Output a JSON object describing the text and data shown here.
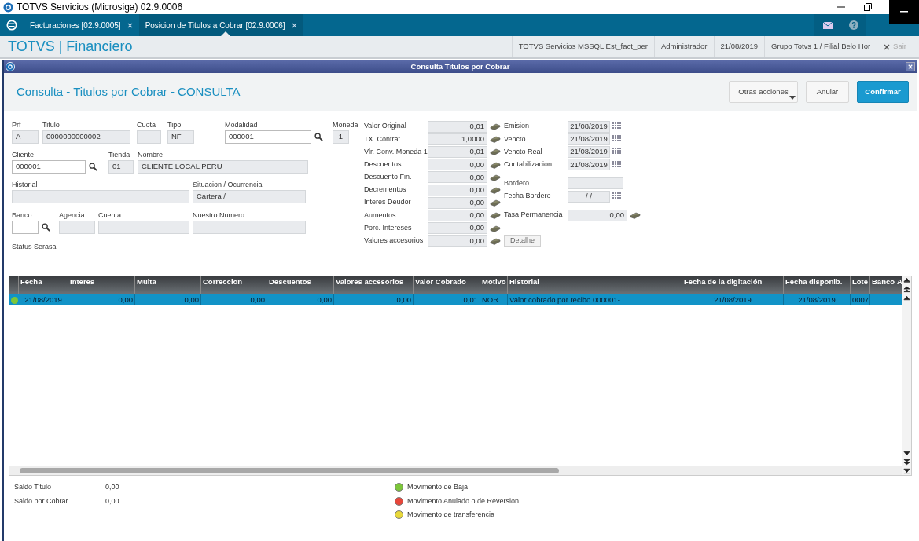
{
  "window": {
    "title": "TOTVS Servicios (Microsiga) 02.9.0006"
  },
  "tabs": [
    {
      "label": "Facturaciones [02.9.0005]",
      "selected": false
    },
    {
      "label": "Posicion de Titulos a Cobrar [02.9.0006]",
      "selected": true
    }
  ],
  "header": {
    "app_title": "TOTVS | Financiero",
    "info": [
      "TOTVS Servicios MSSQL Est_fact_per",
      "Administrador",
      "21/08/2019",
      "Grupo Totvs 1 / Filial Belo Hor"
    ],
    "exit": "Sair"
  },
  "dialog": {
    "title": "Consulta Titulos por Cobrar",
    "form_title": "Consulta - Titulos por Cobrar - CONSULTA",
    "buttons": [
      {
        "label": "Otras acciones",
        "kind": "menu"
      },
      {
        "label": "Anular",
        "kind": "plain"
      },
      {
        "label": "Confirmar",
        "kind": "primary"
      }
    ]
  },
  "fields": [
    [
      {
        "label": "Prf",
        "value": "A",
        "editable": false,
        "lookup": false
      },
      {
        "label": "Titulo",
        "value": "0000000000002",
        "editable": false,
        "lookup": false
      },
      {
        "label": "Cuota",
        "editable": false,
        "lookup": false
      },
      {
        "label": "Tipo",
        "value": "NF",
        "editable": false,
        "lookup": false
      },
      {
        "label": "Modalidad",
        "value": "000001",
        "editable": true,
        "lookup": true
      },
      {
        "label": "Moneda",
        "value": "1",
        "editable": false,
        "lookup": false
      }
    ],
    [
      {
        "label": "Cliente",
        "value": "000001",
        "editable": true,
        "lookup": true
      },
      {
        "label": "Tienda",
        "value": "01",
        "editable": false,
        "lookup": false
      },
      {
        "label": "Nombre",
        "value": "CLIENTE LOCAL PERU",
        "editable": false,
        "lookup": false
      }
    ],
    [
      {
        "label": "Historial",
        "editable": false,
        "lookup": false
      },
      {
        "label": "Situacion / Ocurrencia",
        "value": "Cartera /",
        "editable": false,
        "lookup": false
      }
    ],
    [
      {
        "label": "Banco",
        "editable": true,
        "lookup": true
      },
      {
        "label": "Agencia",
        "editable": false,
        "lookup": false
      },
      {
        "label": "Cuenta",
        "editable": false,
        "lookup": false
      },
      {
        "label": "Nuestro Numero",
        "editable": false,
        "lookup": false
      }
    ]
  ],
  "status_label": "Status Serasa",
  "amounts": [
    {
      "label": "Valor Original",
      "value": "0,01"
    },
    {
      "label": "TX. Contrat",
      "value": "1,0000"
    },
    {
      "label": "Vlr. Conv. Moneda 1",
      "value": "0,01"
    },
    {
      "label": "Descuentos",
      "value": "0,00"
    },
    {
      "label": "Descuento Fin.",
      "value": "0,00"
    },
    {
      "label": "Decrementos",
      "value": "0,00"
    },
    {
      "label": "Interes Deudor",
      "value": "0,00"
    },
    {
      "label": "Aumentos",
      "value": "0,00"
    },
    {
      "label": "Porc. Intereses",
      "value": "0,00"
    },
    {
      "label": "Valores accesorios",
      "value": "0,00"
    }
  ],
  "detail_button": "Detalhe",
  "dates": [
    {
      "label": "Emision",
      "value": "21/08/2019",
      "kind": "date"
    },
    {
      "label": "Vencto",
      "value": "21/08/2019",
      "kind": "date"
    },
    {
      "label": "Vencto Real",
      "value": "21/08/2019",
      "kind": "date"
    },
    {
      "label": "Contabilizacion",
      "value": "21/08/2019",
      "kind": "date"
    },
    {
      "label": "Bordero",
      "kind": "text"
    },
    {
      "label": "Fecha Bordero",
      "value": "/ /",
      "kind": "date"
    },
    {
      "label": "Tasa Permanencia",
      "value": "0,00",
      "kind": "amount"
    }
  ],
  "table": {
    "columns": [
      "Fecha",
      "Interes",
      "Multa",
      "Correccion",
      "Descuentos",
      "Valores accesorios",
      "Valor Cobrado",
      "Motivo",
      "Historial",
      "Fecha de la digitación",
      "Fecha disponib.",
      "Lote",
      "Banco",
      "A"
    ],
    "rows": [
      {
        "selected": true,
        "color": "#7cc63a",
        "cells": [
          "21/08/2019",
          "0,00",
          "0,00",
          "0,00",
          "0,00",
          "0,00",
          "0,01",
          "NOR",
          "Valor cobrado por recibo 000001-",
          "21/08/2019",
          "21/08/2019",
          "0007",
          "",
          ""
        ]
      }
    ]
  },
  "totals": [
    {
      "label": "Saldo Titulo",
      "value": "0,00"
    },
    {
      "label": "Saldo por Cobrar",
      "value": "0,00"
    }
  ],
  "legend": [
    {
      "label": "Movimento de Baja",
      "color": "#7cc63a"
    },
    {
      "label": "Movimento Anulado o de Reversion",
      "color": "#e8463a"
    },
    {
      "label": "Movimento de transferencia",
      "color": "#e8d83a"
    }
  ]
}
